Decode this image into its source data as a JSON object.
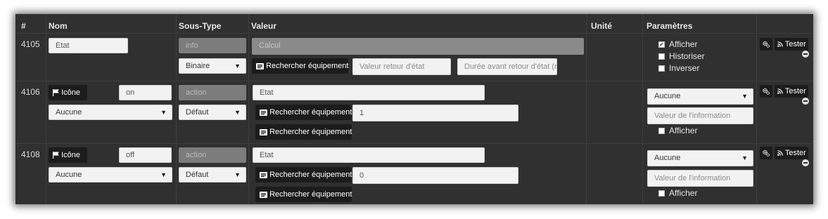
{
  "headers": {
    "id": "#",
    "name": "Nom",
    "subtype": "Sous-Type",
    "value": "Valeur",
    "unit": "Unité",
    "params": "Paramètres"
  },
  "buttons": {
    "search_equipment": "Rechercher équipement",
    "tester": "Tester",
    "icon": "Icône"
  },
  "rows": [
    {
      "id": "4105",
      "name": "Etat",
      "type": "info",
      "subtype": "Binaire",
      "calc_placeholder": "Calcul",
      "return_state_placeholder": "Valeur retour d'état",
      "return_delay_placeholder": "Durée avant retour d'état (r",
      "params": {
        "afficher": "Afficher",
        "afficher_checked": true,
        "historiser": "Historiser",
        "historiser_checked": false,
        "inverser": "Inverser",
        "inverser_checked": false
      }
    },
    {
      "id": "4106",
      "name": "on",
      "icon_select": "Aucune",
      "type": "action",
      "subtype": "Défaut",
      "value": "Etat",
      "value2": "1",
      "param_select": "Aucune",
      "info_placeholder": "Valeur de l'information",
      "afficher": "Afficher",
      "afficher_checked": false
    },
    {
      "id": "4108",
      "name": "off",
      "icon_select": "Aucune",
      "type": "action",
      "subtype": "Défaut",
      "value": "Etat",
      "value2": "0",
      "param_select": "Aucune",
      "info_placeholder": "Valeur de l'information",
      "afficher": "Afficher",
      "afficher_checked": false
    }
  ],
  "icons": {
    "gear": "gears-icon",
    "rss": "rss-icon",
    "flag": "flag-icon",
    "card": "id-card-icon",
    "minus": "minus-circle-icon",
    "check": "checkmark-icon",
    "caret": "caret-down-icon"
  }
}
